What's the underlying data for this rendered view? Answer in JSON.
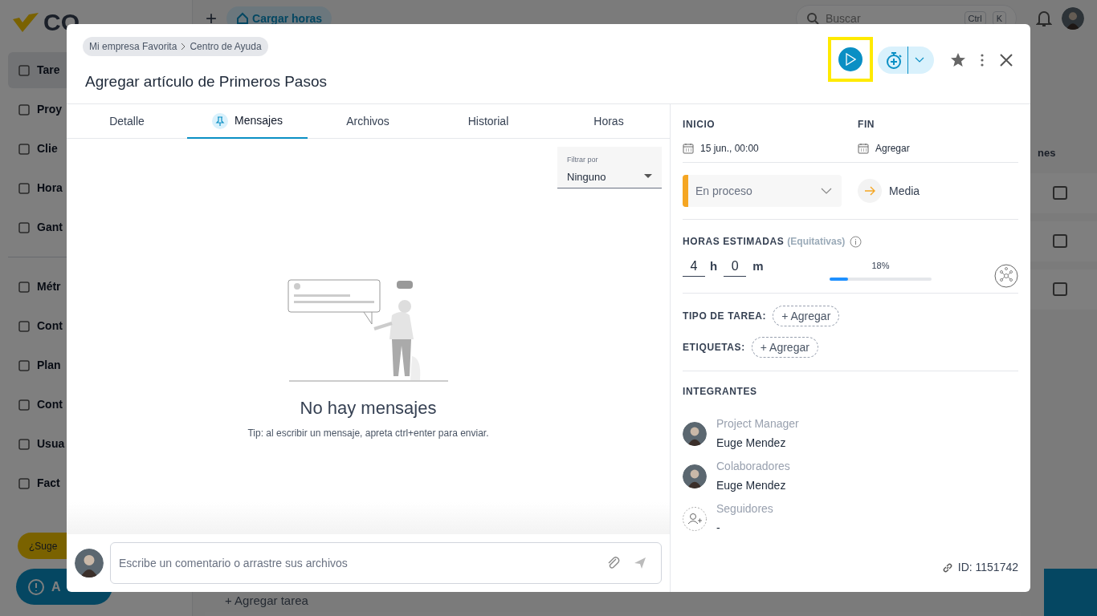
{
  "background": {
    "logo": "CO",
    "new_button": "+",
    "upload_button": "Cargar horas",
    "search": {
      "placeholder": "Buscar"
    },
    "shortcut": [
      "Ctrl",
      "K"
    ],
    "sidebar": {
      "items": [
        {
          "label": "Tare",
          "selected": true
        },
        {
          "label": "Proy",
          "selected": false
        },
        {
          "label": "Clie",
          "selected": false
        },
        {
          "label": "Hora",
          "selected": false
        },
        {
          "label": "Gant",
          "selected": false
        },
        {
          "label": "Métr",
          "selected": false
        },
        {
          "label": "Cont",
          "selected": false
        },
        {
          "label": "Plan",
          "selected": false
        },
        {
          "label": "Cont",
          "selected": false
        },
        {
          "label": "Usua",
          "selected": false
        },
        {
          "label": "Fact",
          "selected": false
        }
      ]
    },
    "suggest_button": "¿Suge",
    "help_button": "A",
    "add_task": "+ Agregar tarea",
    "column_header": "nes"
  },
  "modal": {
    "breadcrumb": [
      "Mi empresa Favorita",
      "Centro de Ayuda"
    ],
    "title": "Agregar artículo de Primeros Pasos",
    "play_button": {
      "highlighted": true
    },
    "tabs": [
      {
        "label": "Detalle",
        "selected": false
      },
      {
        "label": "Mensajes",
        "selected": true
      },
      {
        "label": "Archivos",
        "selected": false
      },
      {
        "label": "Historial",
        "selected": false
      },
      {
        "label": "Horas",
        "selected": false
      }
    ],
    "filter": {
      "label": "Filtrar por",
      "value": "Ninguno"
    },
    "empty": {
      "title": "No hay mensajes",
      "tip": "Tip: al escribir un mensaje, apreta ctrl+enter para enviar."
    },
    "comment": {
      "placeholder": "Escribe un comentario o arrastre sus archivos"
    },
    "start": {
      "label": "INICIO",
      "value": "15 jun., 00:00"
    },
    "end": {
      "label": "FIN",
      "value": "Agregar"
    },
    "status": {
      "text": "En proceso",
      "color": "#f5a623"
    },
    "priority": "Media",
    "estimate": {
      "label": "HORAS ESTIMADAS",
      "note": "(Equitativas)",
      "hours": "4",
      "hours_unit": "h",
      "minutes": "0",
      "minutes_unit": "m",
      "percent": "18%",
      "level": 0.18
    },
    "task_type": {
      "label": "TIPO DE TAREA:",
      "button": "+ Agregar"
    },
    "tags": {
      "label": "ETIQUETAS:",
      "button": "+ Agregar"
    },
    "members": {
      "title": "INTEGRANTES",
      "groups": [
        {
          "kind": "person",
          "role": "Project Manager",
          "name": "Euge Mendez"
        },
        {
          "kind": "person",
          "role": "Colaboradores",
          "name": "Euge Mendez"
        },
        {
          "kind": "add",
          "role": "Seguidores",
          "name": "-"
        }
      ]
    },
    "id": "ID: 1151742"
  }
}
